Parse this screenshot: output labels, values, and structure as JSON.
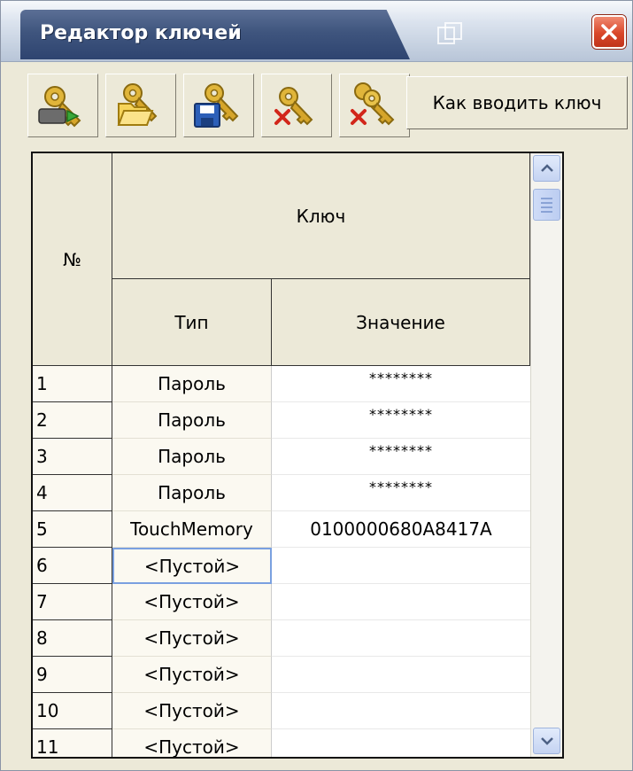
{
  "window": {
    "title": "Редактор ключей"
  },
  "toolbar": {
    "buttons": [
      {
        "icon": "key-import-icon"
      },
      {
        "icon": "key-open-folder-icon"
      },
      {
        "icon": "key-save-icon"
      },
      {
        "icon": "key-delete-icon"
      },
      {
        "icon": "keys-delete-all-icon"
      }
    ],
    "help_label": "Как вводить ключ"
  },
  "table": {
    "header_num": "№",
    "header_key": "Ключ",
    "header_type": "Тип",
    "header_value": "Значение",
    "rows": [
      {
        "num": "1",
        "type": "Пароль",
        "value": "********"
      },
      {
        "num": "2",
        "type": "Пароль",
        "value": "********"
      },
      {
        "num": "3",
        "type": "Пароль",
        "value": "********"
      },
      {
        "num": "4",
        "type": "Пароль",
        "value": "********"
      },
      {
        "num": "5",
        "type": "TouchMemory",
        "value": "0100000680A8417A"
      },
      {
        "num": "6",
        "type": "<Пустой>",
        "value": ""
      },
      {
        "num": "7",
        "type": "<Пустой>",
        "value": ""
      },
      {
        "num": "8",
        "type": "<Пустой>",
        "value": ""
      },
      {
        "num": "9",
        "type": "<Пустой>",
        "value": ""
      },
      {
        "num": "10",
        "type": "<Пустой>",
        "value": ""
      },
      {
        "num": "11",
        "type": "<Пустой>",
        "value": ""
      }
    ]
  },
  "colors": {
    "title_bar": "#3f557e",
    "close_button": "#d9472a",
    "window_bg": "#ece9d8",
    "focus_border": "#7aa0e0"
  }
}
